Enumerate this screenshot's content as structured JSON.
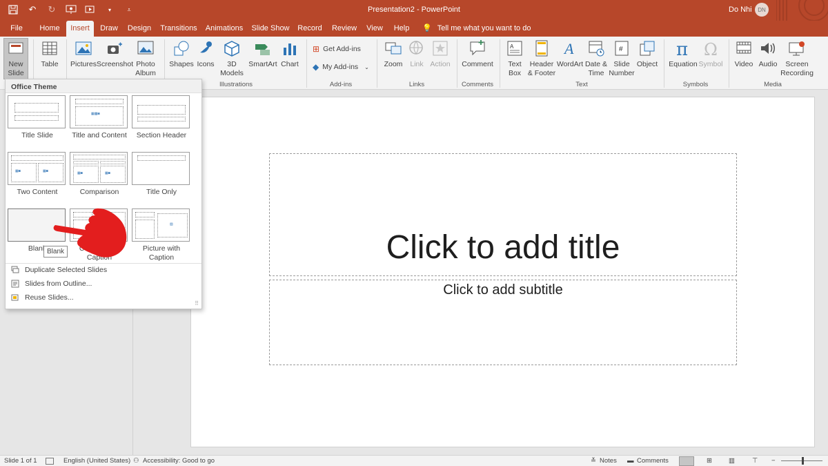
{
  "app": {
    "doc_title": "Presentation2  -  PowerPoint",
    "user_name": "Do Nhi",
    "user_initials": "DN",
    "accent": "#b7472a"
  },
  "qat": [
    "save-icon",
    "undo-icon",
    "redo-icon",
    "present-icon",
    "slideshow-icon",
    "customize-icon"
  ],
  "tabs": [
    "File",
    "Home",
    "Insert",
    "Draw",
    "Design",
    "Transitions",
    "Animations",
    "Slide Show",
    "Record",
    "Review",
    "View",
    "Help"
  ],
  "active_tab": "Insert",
  "tell_me": "Tell me what you want to do",
  "ribbon": {
    "new_slide": [
      "New",
      "Slide"
    ],
    "table": "Table",
    "pictures": "Pictures",
    "screenshot": "Screenshot",
    "photo_album": [
      "Photo",
      "Album"
    ],
    "shapes": "Shapes",
    "icons": "Icons",
    "models_3d": [
      "3D",
      "Models"
    ],
    "smartart": "SmartArt",
    "chart": "Chart",
    "get_addins": "Get Add-ins",
    "my_addins": "My Add-ins",
    "zoom": "Zoom",
    "link": "Link",
    "action": "Action",
    "comment": "Comment",
    "text_box": [
      "Text",
      "Box"
    ],
    "header_footer": [
      "Header",
      "& Footer"
    ],
    "wordart": "WordArt",
    "date_time": [
      "Date &",
      "Time"
    ],
    "slide_number": [
      "Slide",
      "Number"
    ],
    "object": "Object",
    "equation": "Equation",
    "symbol": "Symbol",
    "video": "Video",
    "audio": "Audio",
    "screen_recording": [
      "Screen",
      "Recording"
    ],
    "groups": {
      "illustrations": "Illustrations",
      "addins": "Add-ins",
      "links": "Links",
      "comments": "Comments",
      "text": "Text",
      "symbols": "Symbols",
      "media": "Media"
    }
  },
  "gallery": {
    "header": "Office Theme",
    "layouts": [
      "Title Slide",
      "Title and Content",
      "Section Header",
      "Two Content",
      "Comparison",
      "Title Only",
      "Blank",
      "Content with Caption",
      "Picture with Caption"
    ],
    "menu": [
      "Duplicate Selected Slides",
      "Slides from Outline...",
      "Reuse Slides..."
    ],
    "tooltip": "Blank"
  },
  "slide": {
    "title_placeholder": "Click to add title",
    "subtitle_placeholder": "Click to add subtitle"
  },
  "status": {
    "slide_count": "Slide 1 of 1",
    "language": "English (United States)",
    "accessibility": "Accessibility: Good to go",
    "notes": "Notes",
    "comments": "Comments"
  }
}
